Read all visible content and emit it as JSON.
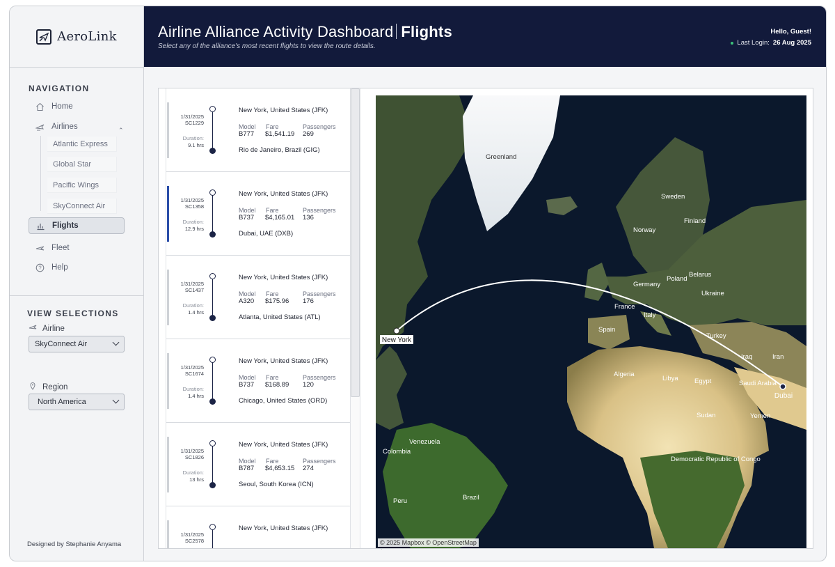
{
  "brand": {
    "name": "AeroLink"
  },
  "header": {
    "title": "Airline Alliance Activity Dashboard",
    "title_bold": "Flights",
    "subtitle": "Select any of the alliance's most recent flights to view the route details.",
    "greeting": "Hello, Guest!",
    "last_login_label": "Last Login:",
    "last_login_value": "26 Aug 2025"
  },
  "sidebar": {
    "nav_title": "NAVIGATION",
    "items": [
      {
        "label": "Home",
        "icon": "home-icon"
      },
      {
        "label": "Airlines",
        "icon": "plane-icon"
      },
      {
        "label": "Flights",
        "icon": "chart-icon"
      },
      {
        "label": "Fleet",
        "icon": "plane-icon"
      },
      {
        "label": "Help",
        "icon": "help-icon"
      }
    ],
    "airlines": [
      "Atlantic Express",
      "Global Star",
      "Pacific Wings",
      "SkyConnect Air"
    ],
    "view_title": "VIEW SELECTIONS",
    "airline_label": "Airline",
    "airline_value": "SkyConnect Air",
    "region_label": "Region",
    "region_value": "North America",
    "designed_by": "Designed by Stephanie Anyama"
  },
  "flights": {
    "model_label": "Model",
    "fare_label": "Fare",
    "passengers_label": "Passengers",
    "duration_label": "Duration:",
    "cards": [
      {
        "date": "1/31/2025",
        "code": "SC1229",
        "duration": "9.1 hrs",
        "from": "New York, United States (JFK)",
        "to": "Rio de Janeiro, Brazil (GIG)",
        "model": "B777",
        "fare": "$1,541.19",
        "passengers": "269",
        "selected": false
      },
      {
        "date": "1/31/2025",
        "code": "SC1358",
        "duration": "12.9 hrs",
        "from": "New York, United States (JFK)",
        "to": "Dubai, UAE (DXB)",
        "model": "B737",
        "fare": "$4,165.01",
        "passengers": "136",
        "selected": true
      },
      {
        "date": "1/31/2025",
        "code": "SC1437",
        "duration": "1.4 hrs",
        "from": "New York, United States (JFK)",
        "to": "Atlanta, United States (ATL)",
        "model": "A320",
        "fare": "$175.96",
        "passengers": "176",
        "selected": false
      },
      {
        "date": "1/31/2025",
        "code": "SC1674",
        "duration": "1.4 hrs",
        "from": "New York, United States (JFK)",
        "to": "Chicago, United States (ORD)",
        "model": "B737",
        "fare": "$168.89",
        "passengers": "120",
        "selected": false
      },
      {
        "date": "1/31/2025",
        "code": "SC1826",
        "duration": "13 hrs",
        "from": "New York, United States (JFK)",
        "to": "Seoul, South Korea (ICN)",
        "model": "B787",
        "fare": "$4,653.15",
        "passengers": "274",
        "selected": false
      },
      {
        "date": "1/31/2025",
        "code": "SC2578",
        "duration": "",
        "from": "New York, United States (JFK)",
        "to": "",
        "model": "",
        "fare": "",
        "passengers": "",
        "selected": false
      }
    ]
  },
  "map": {
    "origin_label": "New York",
    "destination_label": "Dubai",
    "attribution": "© 2025 Mapbox © OpenStreetMap",
    "places": [
      "Greenland",
      "Sweden",
      "Finland",
      "Norway",
      "Belarus",
      "Poland",
      "Germany",
      "Ukraine",
      "France",
      "Italy",
      "Spain",
      "Turkey",
      "Iraq",
      "Iran",
      "Algeria",
      "Libya",
      "Egypt",
      "Saudi Arabia",
      "Sudan",
      "Yemen",
      "Venezuela",
      "Colombia",
      "Brazil",
      "Peru",
      "Democratic Republic of Congo"
    ],
    "colors": {
      "ocean": "#0c1a30",
      "land": "#3d5a2c",
      "desert": "#d8c28a",
      "ice": "#f2f4f6",
      "route": "#ffffff"
    }
  }
}
